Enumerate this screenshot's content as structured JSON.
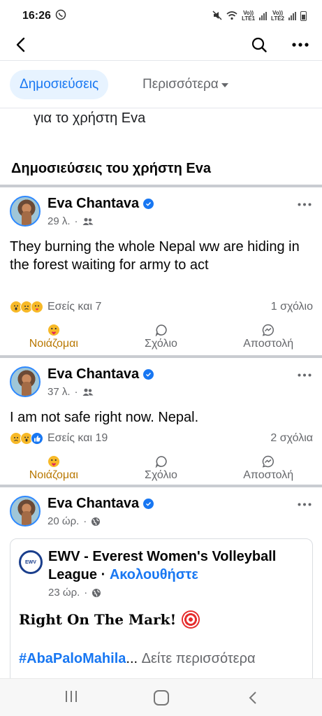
{
  "status_bar": {
    "time": "16:26",
    "lte1": "Vo))\nLTE1",
    "lte2": "Vo))\nLTE2"
  },
  "tabs": {
    "active_label": "Δημοσιεύσεις",
    "more_label": "Περισσότερα"
  },
  "intro_text": "για το χρήστη Eva",
  "section_title": "Δημοσιεύσεις του χρήστη Eva",
  "actions": {
    "care": "Νοιάζομαι",
    "comment": "Σχόλιο",
    "send": "Αποστολή"
  },
  "posts": [
    {
      "author": "Eva Chantava",
      "time": "29 λ.",
      "text": "They burning the whole Nepal ww are hiding in the forest waiting for army to act",
      "reactions_summary": "Εσείς και 7",
      "comments_count": "1 σχόλιο"
    },
    {
      "author": "Eva Chantava",
      "time": "37 λ.",
      "text": "I am not safe right now. Nepal.",
      "reactions_summary": "Εσείς και 19",
      "comments_count": "2 σχόλια"
    },
    {
      "author": "Eva Chantava",
      "time": "20 ώρ.",
      "shared": {
        "page_name": "EWV - Everest Women's Volleyball League",
        "follow": "Ακολουθήστε",
        "time": "23 ώρ.",
        "title": "Right On The Mark!",
        "hashtag": "#AbaPaloMahila",
        "ellipsis": "...",
        "see_more": "Δείτε περισσότερα"
      }
    }
  ],
  "colors": {
    "accent": "#1877f2",
    "care": "#f7b928",
    "care_text": "#b87700",
    "muted": "#65676b"
  }
}
